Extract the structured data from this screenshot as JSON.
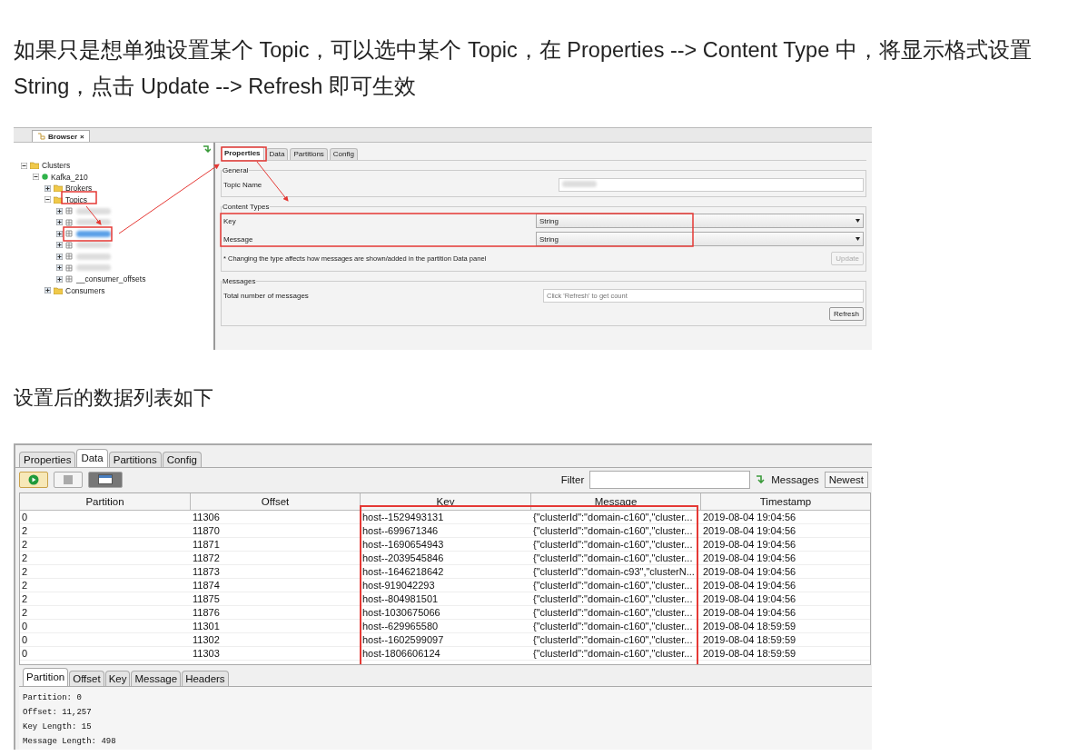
{
  "intro": {
    "lines": [
      "如果只是想单独设置某个 Topic，可以选中某个 Topic，在 Properties --> Content Type 中，将显示格式设置",
      "String，点击 Update --> Refresh 即可生效"
    ]
  },
  "screenshot_1": {
    "view_tab": {
      "label": "Browser",
      "close": "×"
    },
    "tree": [
      {
        "label": "Clusters",
        "kind": "folder",
        "expanded": true,
        "children": [
          {
            "label": "Kafka_210",
            "kind": "cluster",
            "expanded": true,
            "children": [
              {
                "label": "Brokers",
                "kind": "folder",
                "expanded": false
              },
              {
                "label": "Topics",
                "kind": "folder",
                "expanded": true,
                "children": [
                  {
                    "kind": "redacted",
                    "selected": false
                  },
                  {
                    "kind": "redacted",
                    "selected": false
                  },
                  {
                    "kind": "redacted",
                    "selected": true
                  },
                  {
                    "kind": "redacted",
                    "selected": false
                  },
                  {
                    "kind": "redacted",
                    "selected": false
                  },
                  {
                    "kind": "redacted",
                    "selected": false
                  },
                  {
                    "kind": "topic",
                    "label": "__consumer_offsets",
                    "selected": false
                  }
                ]
              },
              {
                "label": "Consumers",
                "kind": "folder",
                "expanded": false
              }
            ]
          }
        ]
      }
    ],
    "tabs": [
      {
        "label": "Properties",
        "selected": true
      },
      {
        "label": "Data",
        "selected": false
      },
      {
        "label": "Partitions",
        "selected": false
      },
      {
        "label": "Config",
        "selected": false
      }
    ],
    "general": {
      "title": "General",
      "topic_name_label": "Topic Name"
    },
    "content_types": {
      "title": "Content Types",
      "rows": [
        {
          "label": "Key",
          "value": "String"
        },
        {
          "label": "Message",
          "value": "String"
        }
      ],
      "note": "* Changing the type affects how messages are shown/added in the partition Data panel",
      "update_button": {
        "label": "Update",
        "disabled": true
      }
    },
    "messages": {
      "title": "Messages",
      "total_label": "Total number of messages",
      "placeholder": "Click 'Refresh' to get count",
      "refresh_button": "Refresh"
    }
  },
  "caption": "设置后的数据列表如下",
  "screenshot_2": {
    "tabs": [
      {
        "label": "Properties",
        "selected": false
      },
      {
        "label": "Data",
        "selected": true
      },
      {
        "label": "Partitions",
        "selected": false
      },
      {
        "label": "Config",
        "selected": false
      }
    ],
    "filter_label": "Filter",
    "messages_label": "Messages",
    "messages_value": "Newest",
    "columns": [
      "Partition",
      "Offset",
      "Key",
      "Message",
      "Timestamp"
    ],
    "rows": [
      [
        "0",
        "11306",
        "host--1529493131",
        "{\"clusterId\":\"domain-c160\",\"cluster...",
        "2019-08-04 19:04:56"
      ],
      [
        "2",
        "11870",
        "host--699671346",
        "{\"clusterId\":\"domain-c160\",\"cluster...",
        "2019-08-04 19:04:56"
      ],
      [
        "2",
        "11871",
        "host--1690654943",
        "{\"clusterId\":\"domain-c160\",\"cluster...",
        "2019-08-04 19:04:56"
      ],
      [
        "2",
        "11872",
        "host--2039545846",
        "{\"clusterId\":\"domain-c160\",\"cluster...",
        "2019-08-04 19:04:56"
      ],
      [
        "2",
        "11873",
        "host--1646218642",
        "{\"clusterId\":\"domain-c93\",\"clusterN...",
        "2019-08-04 19:04:56"
      ],
      [
        "2",
        "11874",
        "host-919042293",
        "{\"clusterId\":\"domain-c160\",\"cluster...",
        "2019-08-04 19:04:56"
      ],
      [
        "2",
        "11875",
        "host--804981501",
        "{\"clusterId\":\"domain-c160\",\"cluster...",
        "2019-08-04 19:04:56"
      ],
      [
        "2",
        "11876",
        "host-1030675066",
        "{\"clusterId\":\"domain-c160\",\"cluster...",
        "2019-08-04 19:04:56"
      ],
      [
        "0",
        "11301",
        "host--629965580",
        "{\"clusterId\":\"domain-c160\",\"cluster...",
        "2019-08-04 18:59:59"
      ],
      [
        "0",
        "11302",
        "host--1602599097",
        "{\"clusterId\":\"domain-c160\",\"cluster...",
        "2019-08-04 18:59:59"
      ],
      [
        "0",
        "11303",
        "host-1806606124",
        "{\"clusterId\":\"domain-c160\",\"cluster...",
        "2019-08-04 18:59:59"
      ]
    ],
    "detail_tabs": [
      {
        "label": "Partition",
        "selected": true
      },
      {
        "label": "Offset",
        "selected": false
      },
      {
        "label": "Key",
        "selected": false
      },
      {
        "label": "Message",
        "selected": false
      },
      {
        "label": "Headers",
        "selected": false
      }
    ],
    "detail_lines": [
      "Partition: 0",
      "Offset: 11,257",
      "Key Length: 15",
      "Message Length: 498"
    ]
  }
}
